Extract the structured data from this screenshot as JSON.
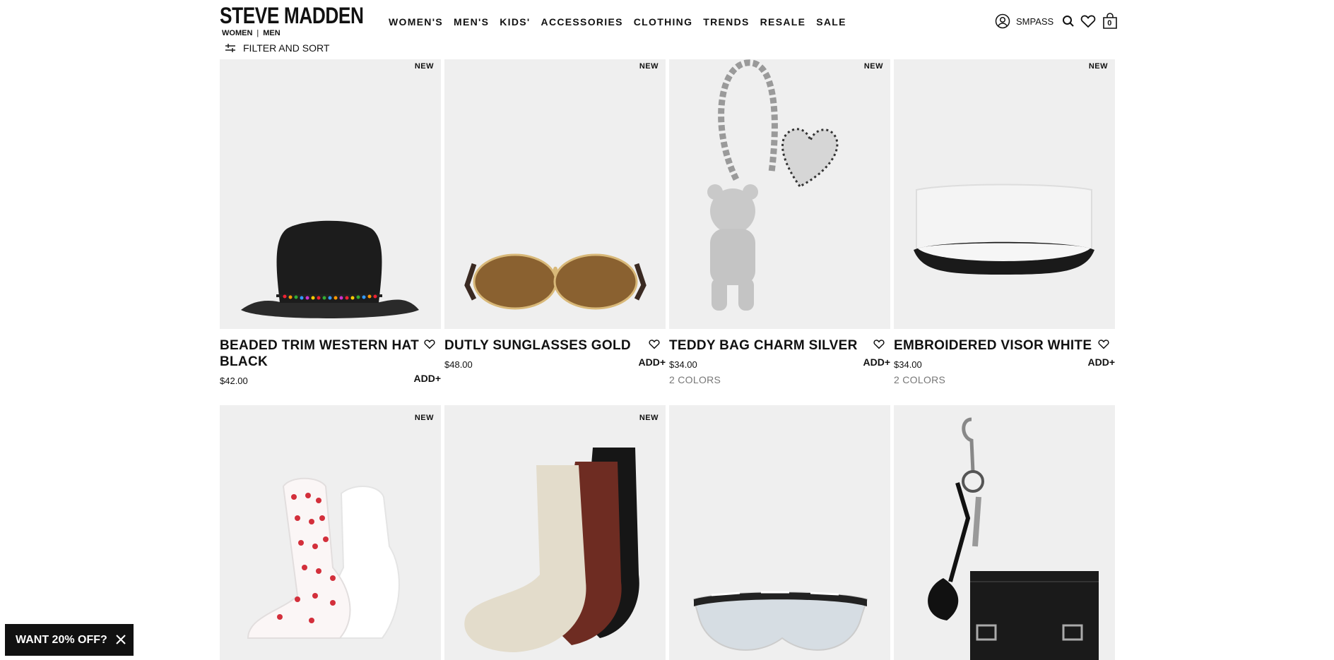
{
  "header": {
    "logo": "STEVE MADDEN",
    "gender_links": [
      "WOMEN",
      "MEN"
    ],
    "gender_sep": "|",
    "nav": [
      "WOMEN'S",
      "MEN'S",
      "KIDS'",
      "ACCESSORIES",
      "CLOTHING",
      "TRENDS",
      "RESALE",
      "SALE"
    ],
    "filter_label": "FILTER AND SORT",
    "smpass_label": "SMPASS",
    "cart_count": "0"
  },
  "products": [
    {
      "name": "BEADED TRIM WESTERN HAT BLACK",
      "price": "$42.00",
      "badge": "NEW",
      "add": "ADD+",
      "colors": "",
      "icon": "hat"
    },
    {
      "name": "DUTLY SUNGLASSES GOLD",
      "price": "$48.00",
      "badge": "NEW",
      "add": "ADD+",
      "colors": "",
      "icon": "sunglasses"
    },
    {
      "name": "TEDDY BAG CHARM SILVER",
      "price": "$34.00",
      "badge": "NEW",
      "add": "ADD+",
      "colors": "2 COLORS",
      "icon": "bag-charm"
    },
    {
      "name": "EMBROIDERED VISOR WHITE",
      "price": "$34.00",
      "badge": "NEW",
      "add": "ADD+",
      "colors": "2 COLORS",
      "icon": "visor"
    },
    {
      "name": "",
      "price": "",
      "badge": "NEW",
      "add": "",
      "colors": "",
      "icon": "socks-white"
    },
    {
      "name": "",
      "price": "",
      "badge": "NEW",
      "add": "",
      "colors": "",
      "icon": "socks-ribbed"
    },
    {
      "name": "",
      "price": "",
      "badge": "",
      "add": "",
      "colors": "",
      "icon": "shield-sunglasses"
    },
    {
      "name": "",
      "price": "",
      "badge": "",
      "add": "",
      "colors": "",
      "icon": "keychain-pouch"
    }
  ],
  "promo": {
    "label": "WANT 20% OFF?"
  },
  "colors": {
    "tile_bg": "#efefef",
    "text": "#111111",
    "muted": "#777777",
    "promo_bg": "#111111"
  }
}
